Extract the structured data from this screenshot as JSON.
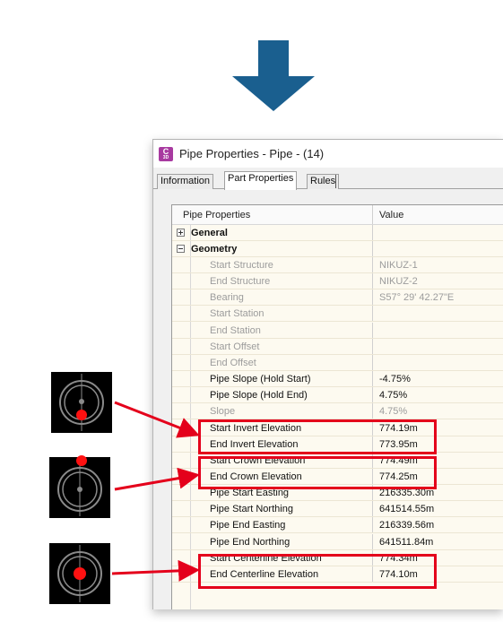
{
  "colors": {
    "arrow": "#1a5f8f",
    "highlight": "#e4001b",
    "grid_bg": "#fdfaf0",
    "disabled_text": "#9c9c9c"
  },
  "window": {
    "title": "Pipe Properties - Pipe - (14)",
    "icon": "civil3d-app-icon",
    "icon_letter": "C",
    "icon_sub": "3D"
  },
  "tabs": [
    {
      "label": "Information",
      "active": false
    },
    {
      "label": "Part Properties",
      "active": true
    },
    {
      "label": "Rules",
      "active": false
    }
  ],
  "grid": {
    "header": {
      "property": "Pipe Properties",
      "value": "Value"
    },
    "categories": [
      {
        "label": "General",
        "expanded": false
      },
      {
        "label": "Geometry",
        "expanded": true
      }
    ],
    "rows": [
      {
        "label": "Start Structure",
        "value": "NIKUZ-1",
        "enabled": false
      },
      {
        "label": "End Structure",
        "value": "NIKUZ-2",
        "enabled": false
      },
      {
        "label": "Bearing",
        "value": "S57° 29' 42.27\"E",
        "enabled": false
      },
      {
        "label": "Start Station",
        "value": "",
        "enabled": false
      },
      {
        "label": "End Station",
        "value": "",
        "enabled": false
      },
      {
        "label": "Start Offset",
        "value": "",
        "enabled": false
      },
      {
        "label": "End Offset",
        "value": "",
        "enabled": false
      },
      {
        "label": "Pipe Slope (Hold Start)",
        "value": "-4.75%",
        "enabled": true
      },
      {
        "label": "Pipe Slope (Hold End)",
        "value": "4.75%",
        "enabled": true
      },
      {
        "label": "Slope",
        "value": "4.75%",
        "enabled": false
      },
      {
        "label": "Start Invert Elevation",
        "value": "774.19m",
        "enabled": true
      },
      {
        "label": "End Invert Elevation",
        "value": "773.95m",
        "enabled": true
      },
      {
        "label": "Start Crown Elevation",
        "value": "774.49m",
        "enabled": true
      },
      {
        "label": "End Crown Elevation",
        "value": "774.25m",
        "enabled": true
      },
      {
        "label": "Pipe Start Easting",
        "value": "216335.30m",
        "enabled": true
      },
      {
        "label": "Pipe Start Northing",
        "value": "641514.55m",
        "enabled": true
      },
      {
        "label": "Pipe End Easting",
        "value": "216339.56m",
        "enabled": true
      },
      {
        "label": "Pipe End Northing",
        "value": "641511.84m",
        "enabled": true
      },
      {
        "label": "Start Centerline Elevation",
        "value": "774.34m",
        "enabled": true
      },
      {
        "label": "End Centerline Elevation",
        "value": "774.10m",
        "enabled": true
      }
    ]
  },
  "callouts": [
    {
      "name": "invert-elevation",
      "marker": "bottom"
    },
    {
      "name": "crown-elevation",
      "marker": "top"
    },
    {
      "name": "centerline-elevation",
      "marker": "center"
    }
  ]
}
